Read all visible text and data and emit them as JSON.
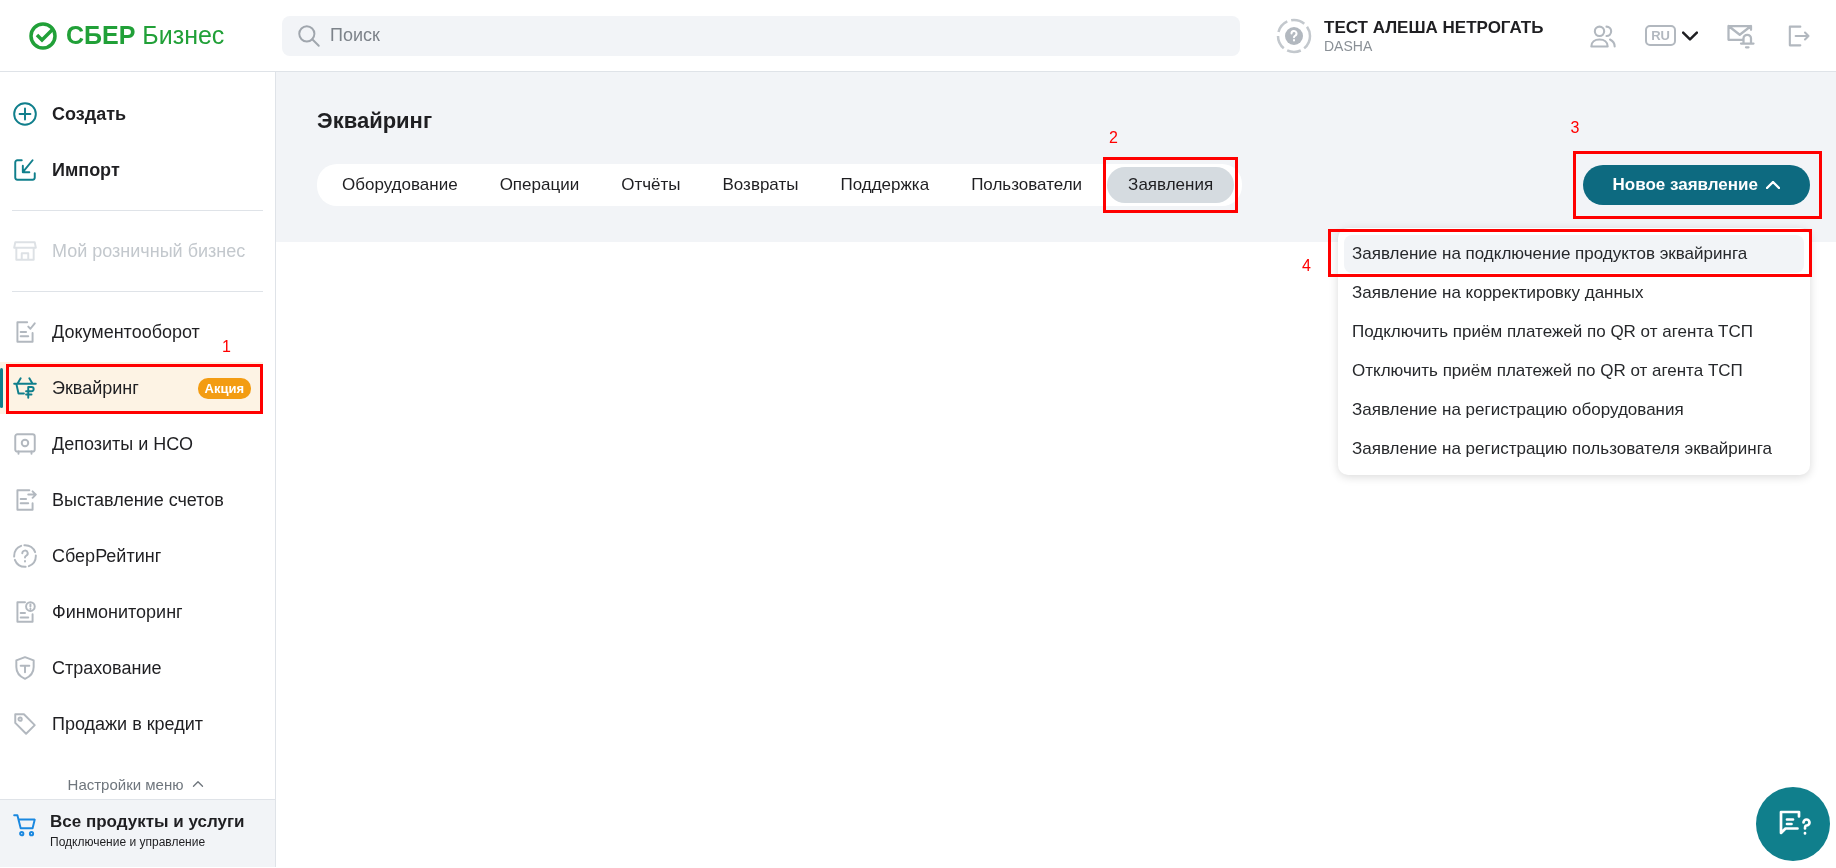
{
  "header": {
    "logo": {
      "brand": "СБЕР",
      "product": "Бизнес"
    },
    "search": {
      "placeholder": "Поиск"
    },
    "user": {
      "name": "ТЕСТ АЛЕША НЕТРОГАТЬ",
      "login": "DASHA"
    },
    "language": "RU"
  },
  "sidebar": {
    "sections": [
      {
        "items": [
          {
            "label": "Создать",
            "kind": "action",
            "disabled": false,
            "selected": false
          },
          {
            "label": "Импорт",
            "kind": "action",
            "disabled": false,
            "selected": false
          }
        ]
      },
      {
        "items": [
          {
            "label": "Мой розничный бизнес",
            "kind": "product",
            "disabled": true,
            "selected": false
          }
        ]
      },
      {
        "items": [
          {
            "label": "Документооборот",
            "kind": "product",
            "disabled": false,
            "selected": false
          },
          {
            "label": "Эквайринг",
            "kind": "product",
            "disabled": false,
            "selected": true,
            "badge": "Акция",
            "annotation": "1"
          },
          {
            "label": "Депозиты и НСО",
            "kind": "product",
            "disabled": false,
            "selected": false
          },
          {
            "label": "Выставление счетов",
            "kind": "product",
            "disabled": false,
            "selected": false
          },
          {
            "label": "СберРейтинг",
            "kind": "product",
            "disabled": false,
            "selected": false
          },
          {
            "label": "Финмониторинг",
            "kind": "product",
            "disabled": false,
            "selected": false
          },
          {
            "label": "Страхование",
            "kind": "product",
            "disabled": false,
            "selected": false
          },
          {
            "label": "Продажи в кредит",
            "kind": "product",
            "disabled": false,
            "selected": false
          }
        ]
      }
    ],
    "menu_settings": {
      "label": "Настройки меню",
      "expanded": true
    },
    "all_products": {
      "title": "Все продукты и услуги",
      "subtitle": "Подключение и управление"
    }
  },
  "main": {
    "title": "Эквайринг",
    "tabs": [
      {
        "label": "Оборудование",
        "selected": false
      },
      {
        "label": "Операции",
        "selected": false
      },
      {
        "label": "Отчёты",
        "selected": false
      },
      {
        "label": "Возвраты",
        "selected": false
      },
      {
        "label": "Поддержка",
        "selected": false
      },
      {
        "label": "Пользователи",
        "selected": false
      },
      {
        "label": "Заявления",
        "selected": true,
        "annotation": "2"
      }
    ],
    "new_button": {
      "label": "Новое заявление",
      "expanded": true,
      "annotation": "3"
    },
    "dropdown": [
      {
        "label": "Заявление на подключение продуктов эквайринга",
        "highlighted": true,
        "annotation": "4"
      },
      {
        "label": "Заявление на корректировку данных",
        "highlighted": false
      },
      {
        "label": "Подключить приём платежей по QR от агента ТСП",
        "highlighted": false
      },
      {
        "label": "Отключить приём платежей по QR от агента ТСП",
        "highlighted": false
      },
      {
        "label": "Заявление на регистрацию оборудования",
        "highlighted": false
      },
      {
        "label": "Заявление на регистрацию пользователя эквайринга",
        "highlighted": false
      }
    ]
  }
}
